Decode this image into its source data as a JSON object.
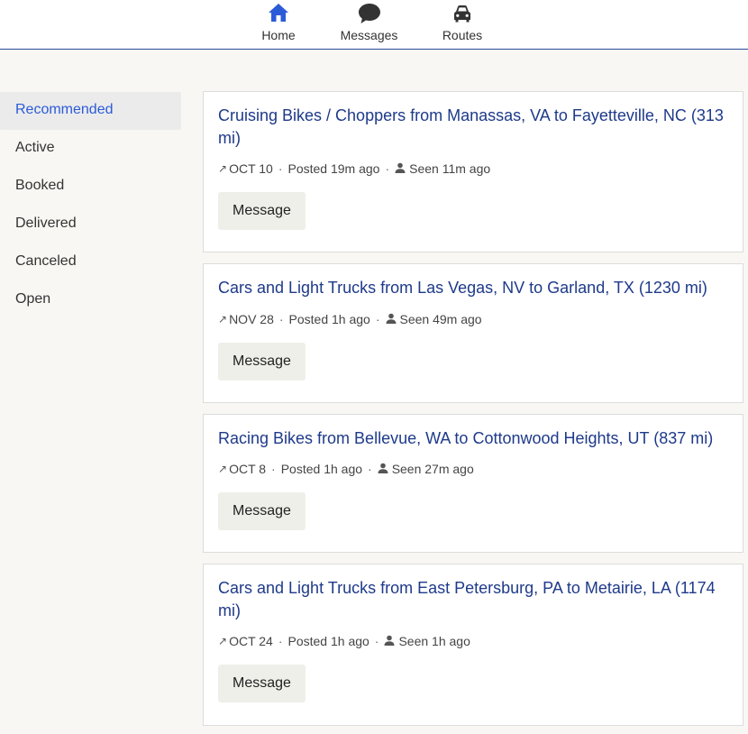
{
  "nav": {
    "home": "Home",
    "messages": "Messages",
    "routes": "Routes",
    "active_color": "#2b5bd7"
  },
  "sidebar": {
    "items": [
      {
        "label": "Recommended",
        "active": true
      },
      {
        "label": "Active"
      },
      {
        "label": "Booked"
      },
      {
        "label": "Delivered"
      },
      {
        "label": "Canceled"
      },
      {
        "label": "Open"
      }
    ]
  },
  "cards": [
    {
      "title": "Cruising Bikes / Choppers from Manassas, VA to Fayetteville, NC (313 mi)",
      "date": "OCT 10",
      "posted": "Posted 19m ago",
      "seen": "Seen 11m ago",
      "button": "Message"
    },
    {
      "title": "Cars and Light Trucks from Las Vegas, NV to Garland, TX (1230 mi)",
      "date": "NOV 28",
      "posted": "Posted 1h ago",
      "seen": "Seen 49m ago",
      "button": "Message"
    },
    {
      "title": "Racing Bikes from Bellevue, WA to Cottonwood Heights, UT (837 mi)",
      "date": "OCT 8",
      "posted": "Posted 1h ago",
      "seen": "Seen 27m ago",
      "button": "Message"
    },
    {
      "title": "Cars and Light Trucks from East Petersburg, PA to Metairie, LA (1174 mi)",
      "date": "OCT 24",
      "posted": "Posted 1h ago",
      "seen": "Seen 1h ago",
      "button": "Message"
    }
  ]
}
